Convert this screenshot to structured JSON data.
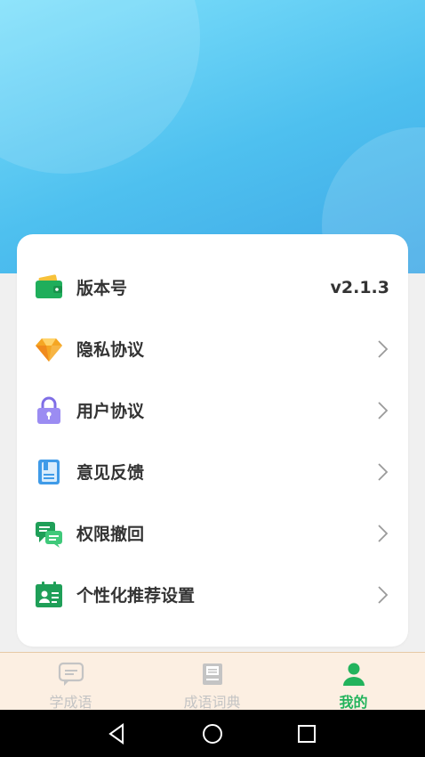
{
  "settings": {
    "items": [
      {
        "label": "版本号",
        "value": "v2.1.3",
        "icon": "wallet-icon",
        "has_chevron": false
      },
      {
        "label": "隐私协议",
        "icon": "diamond-icon",
        "has_chevron": true
      },
      {
        "label": "用户协议",
        "icon": "lock-icon",
        "has_chevron": true
      },
      {
        "label": "意见反馈",
        "icon": "notebook-icon",
        "has_chevron": true
      },
      {
        "label": "权限撤回",
        "icon": "chat-bubbles-icon",
        "has_chevron": true
      },
      {
        "label": "个性化推荐设置",
        "icon": "profile-card-icon",
        "has_chevron": true
      }
    ]
  },
  "tabbar": {
    "tabs": [
      {
        "label": "学成语",
        "icon": "chat-icon",
        "active": false
      },
      {
        "label": "成语词典",
        "icon": "dictionary-icon",
        "active": false
      },
      {
        "label": "我的",
        "icon": "user-icon",
        "active": true
      }
    ]
  },
  "colors": {
    "accent": "#22b35c",
    "hero_light": "#7fe0fb",
    "hero_dark": "#3fa8e6",
    "tabbar_bg": "#fcefe2",
    "inactive": "#c4c4c4"
  },
  "system_nav": {
    "buttons": [
      "back-icon",
      "home-icon",
      "recents-icon"
    ]
  }
}
